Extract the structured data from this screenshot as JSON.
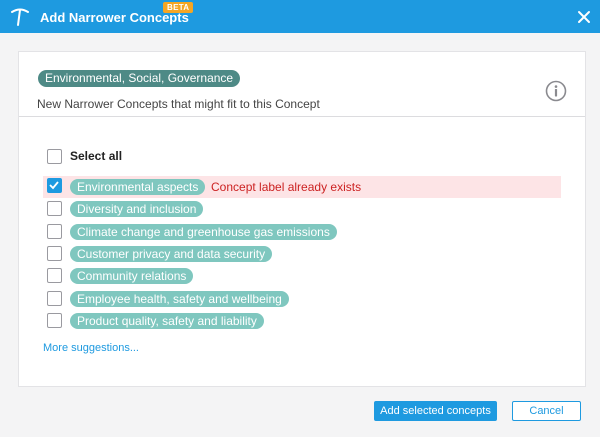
{
  "dialog": {
    "title": "Add Narrower Concepts",
    "badge": "BETA",
    "accent_color": "#1e9ae0"
  },
  "icons": {
    "logo": "pickaxe-logo-icon",
    "close": "close-icon",
    "info": "info-icon",
    "check": "check-icon"
  },
  "panel": {
    "concept": "Environmental, Social, Governance",
    "subtitle": "New Narrower Concepts that might fit to this Concept",
    "select_all_label": "Select all",
    "select_all_checked": false,
    "error_message": "Concept label already exists",
    "items": [
      {
        "label": "Environmental aspects",
        "checked": true,
        "error": true
      },
      {
        "label": "Diversity and inclusion",
        "checked": false,
        "error": false
      },
      {
        "label": "Climate change and greenhouse gas emissions",
        "checked": false,
        "error": false
      },
      {
        "label": "Customer privacy and data security",
        "checked": false,
        "error": false
      },
      {
        "label": "Community relations",
        "checked": false,
        "error": false
      },
      {
        "label": "Employee health, safety and wellbeing",
        "checked": false,
        "error": false
      },
      {
        "label": "Product quality, safety and liability",
        "checked": false,
        "error": false
      }
    ],
    "more_suggestions": "More suggestions..."
  },
  "footer": {
    "add_button": "Add selected concepts",
    "cancel_button": "Cancel"
  }
}
